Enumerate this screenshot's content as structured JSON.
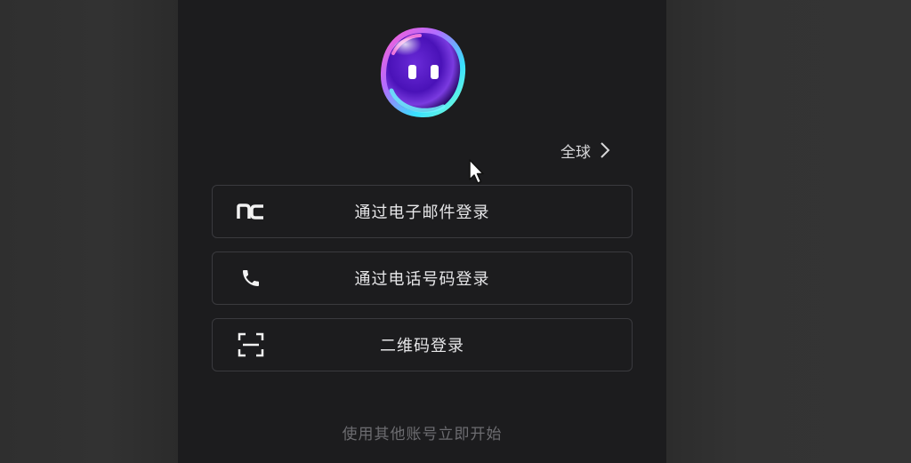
{
  "region": {
    "label": "全球"
  },
  "login_options": [
    {
      "label": "通过电子邮件登录",
      "icon": "nc-logo-icon"
    },
    {
      "label": "通过电话号码登录",
      "icon": "phone-icon"
    },
    {
      "label": "二维码登录",
      "icon": "qr-scan-icon"
    }
  ],
  "footer": {
    "other_accounts": "使用其他账号立即开始"
  },
  "colors": {
    "panel_bg": "#1c1c1e",
    "backdrop": "#333333",
    "button_border": "#3a3a3e",
    "text": "#e6e6e8",
    "muted_text": "#6c6c70"
  }
}
